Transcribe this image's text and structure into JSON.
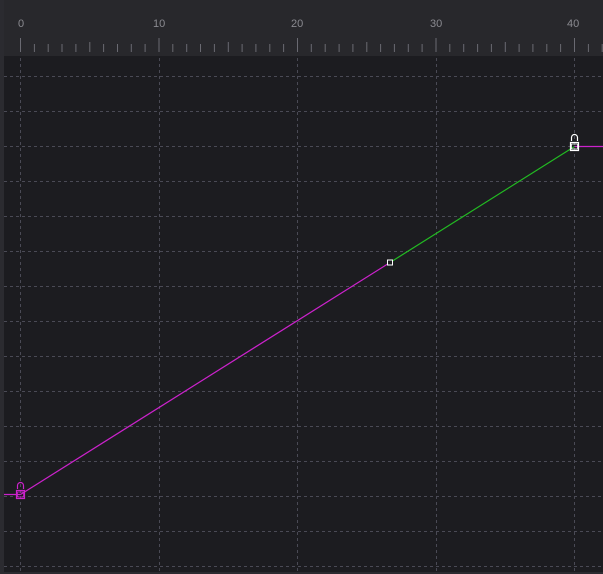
{
  "time_ruler": {
    "tick_labels": [
      "0",
      "10",
      "20",
      "30",
      "40"
    ]
  },
  "curve": {
    "keyframes": [
      {
        "frame": 0,
        "value": 0.0,
        "locked": true
      },
      {
        "frame": 27,
        "value": 0.67
      },
      {
        "frame": 40,
        "value": 1.0,
        "locked": true
      }
    ],
    "colors": {
      "segment_1": "#cc22cc",
      "segment_2": "#22bb22",
      "extrapolation": "#cc22cc",
      "keyframe_locked": "#cc22cc",
      "keyframe_selected": "#ffffff",
      "grid": "#4a4a55"
    }
  }
}
